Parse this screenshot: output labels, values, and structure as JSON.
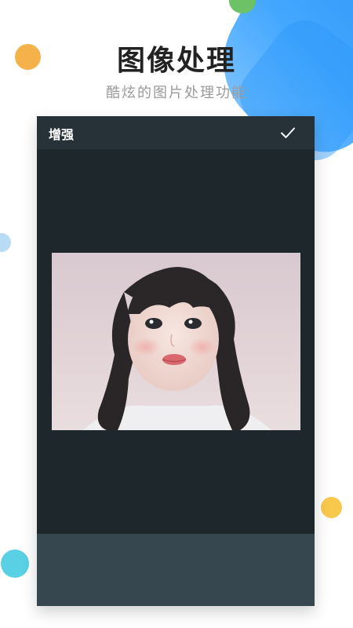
{
  "header": {
    "title": "图像处理",
    "subtitle": "酷炫的图片处理功能"
  },
  "screen": {
    "toolbar_title": "增强",
    "confirm_icon": "check-icon"
  },
  "colors": {
    "toolbar": "#263238",
    "canvas": "#1e272b",
    "bottom_bar": "#37474f",
    "accent_blue": "#2d98f9"
  }
}
